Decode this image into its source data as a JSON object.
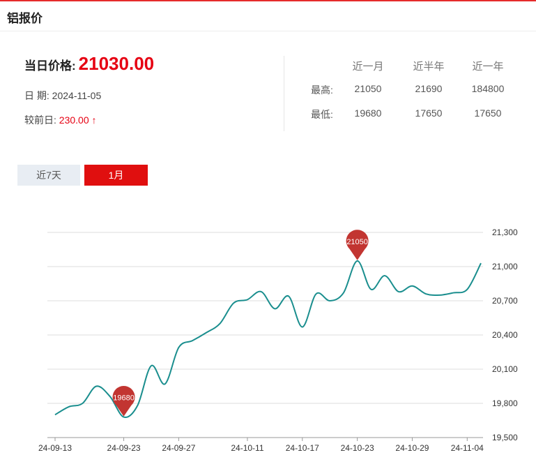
{
  "header": {
    "title": "铝报价"
  },
  "summary": {
    "price_label": "当日价格:",
    "price_value": "21030.00",
    "date_label": "日 期:",
    "date_value": "2024-11-05",
    "change_label": "较前日:",
    "change_value": "230.00",
    "change_arrow": "↑"
  },
  "stats": {
    "headers": [
      "近一月",
      "近半年",
      "近一年"
    ],
    "rows": [
      {
        "label": "最高:",
        "values": [
          "21050",
          "21690",
          "184800"
        ]
      },
      {
        "label": "最低:",
        "values": [
          "19680",
          "17650",
          "17650"
        ]
      }
    ]
  },
  "tabs": {
    "week_label": "近7天",
    "month_label": "1月"
  },
  "colors": {
    "accent": "#e60012",
    "line": "#1a8e8e",
    "pin": "#c23531",
    "grid": "#dddddd"
  },
  "chart_data": {
    "type": "line",
    "x": [
      "24-09-13",
      "24-09-16",
      "24-09-18",
      "24-09-19",
      "24-09-20",
      "24-09-23",
      "24-09-24",
      "24-09-25",
      "24-09-26",
      "24-09-27",
      "24-09-30",
      "24-10-08",
      "24-10-09",
      "24-10-10",
      "24-10-11",
      "24-10-14",
      "24-10-15",
      "24-10-16",
      "24-10-17",
      "24-10-18",
      "24-10-21",
      "24-10-22",
      "24-10-23",
      "24-10-24",
      "24-10-25",
      "24-10-28",
      "24-10-29",
      "24-10-30",
      "24-10-31",
      "24-11-01",
      "24-11-04",
      "24-11-05"
    ],
    "values": [
      19700,
      19770,
      19800,
      19950,
      19860,
      19680,
      19780,
      20130,
      19970,
      20290,
      20350,
      20420,
      20500,
      20680,
      20710,
      20780,
      20630,
      20740,
      20470,
      20760,
      20700,
      20770,
      21050,
      20800,
      20920,
      20780,
      20830,
      20760,
      20750,
      20770,
      20800,
      21030
    ],
    "x_ticks": [
      "24-09-13",
      "24-09-23",
      "24-09-27",
      "24-10-11",
      "24-10-17",
      "24-10-23",
      "24-10-29",
      "24-11-04"
    ],
    "y_ticks": [
      "19,500",
      "19,800",
      "20,100",
      "20,400",
      "20,700",
      "21,000",
      "21,300"
    ],
    "ylim": [
      19500,
      21300
    ],
    "grid": true,
    "markers": [
      {
        "label": "19680",
        "value": 19680,
        "x": "24-09-23"
      },
      {
        "label": "21050",
        "value": 21050,
        "x": "24-10-23"
      }
    ]
  }
}
